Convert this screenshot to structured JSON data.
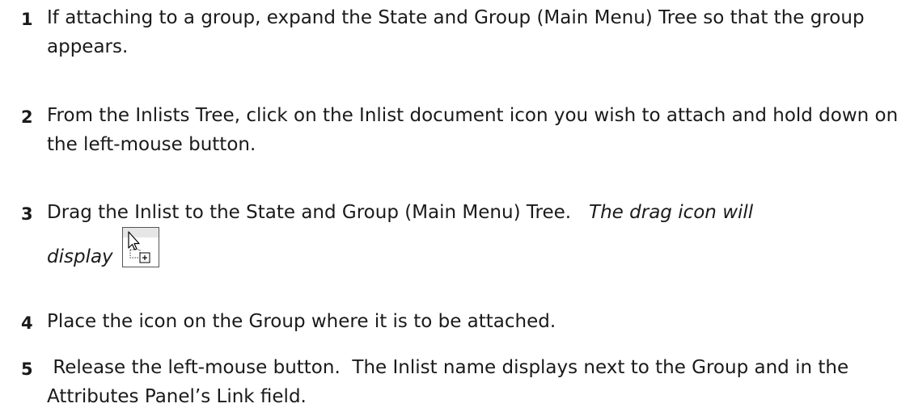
{
  "steps": [
    {
      "number": "1",
      "text": "If attaching to a group, expand the State and Group (Main Menu) Tree so that the group appears."
    },
    {
      "number": "2",
      "text": "From the Inlists Tree, click on the Inlist document icon you wish to attach and hold down on the left-mouse button."
    },
    {
      "number": "3",
      "text": "Drag the Inlist to the State and Group (Main Menu) Tree.",
      "note_line1": "The drag icon will",
      "note_line2": "display",
      "icon": "drag-copy-cursor-icon"
    },
    {
      "number": "4",
      "text": "Place the icon on the Group where it is to be attached."
    },
    {
      "number": "5",
      "text": " Release the left-mouse button.  The Inlist name displays next to the Group and in the Attributes Panel’s Link field."
    }
  ]
}
